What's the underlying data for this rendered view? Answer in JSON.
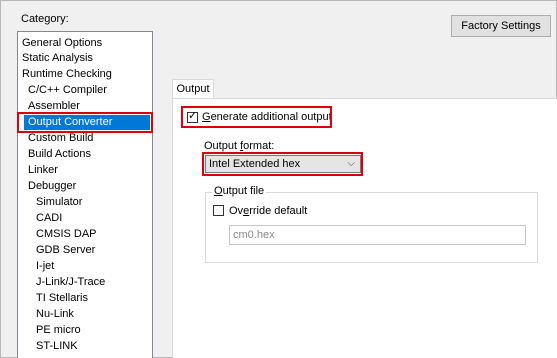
{
  "category": {
    "label": "Category:",
    "items": [
      "General Options",
      "Static Analysis",
      "Runtime Checking",
      "C/C++ Compiler",
      "Assembler",
      "Output Converter",
      "Custom Build",
      "Build Actions",
      "Linker",
      "Debugger",
      "Simulator",
      "CADI",
      "CMSIS DAP",
      "GDB Server",
      "I-jet",
      "J-Link/J-Trace",
      "TI Stellaris",
      "Nu-Link",
      "PE micro",
      "ST-LINK"
    ],
    "selected": "Output Converter"
  },
  "factory_settings_label": "Factory Settings",
  "tabs": [
    {
      "label": "Output"
    }
  ],
  "output": {
    "generate_label": "Generate additional output",
    "generate_checked": true,
    "format_label": "Output format:",
    "format_value": "Intel Extended hex",
    "output_file_legend": "Output file",
    "override_label": "Override default",
    "override_checked": false,
    "file_value": "cm0.hex"
  },
  "colors": {
    "selection": "#0078d7",
    "highlight_box": "#d9000e"
  }
}
